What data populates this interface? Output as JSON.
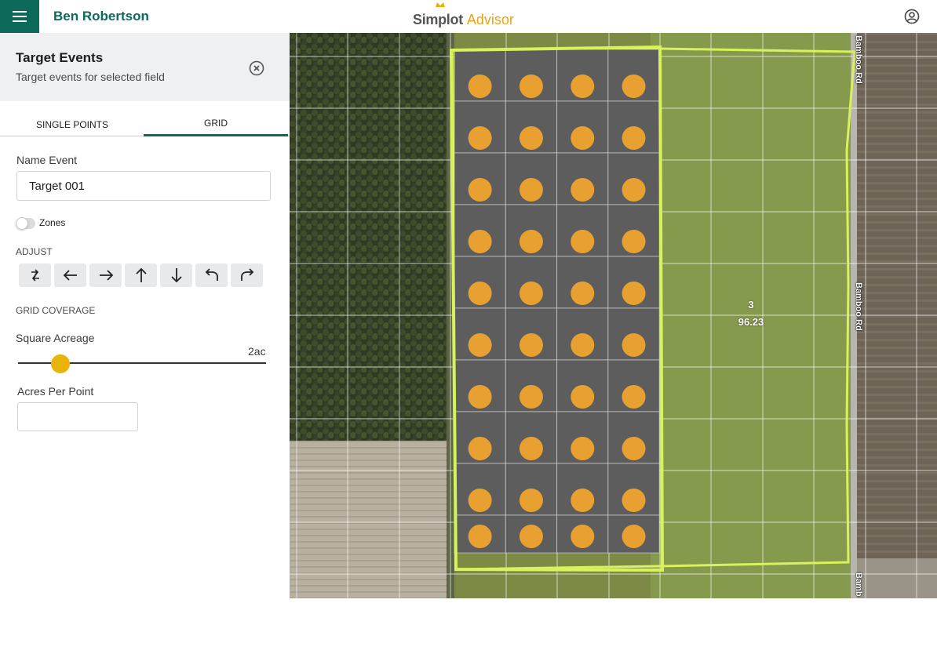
{
  "header": {
    "user_name": "Ben Robertson",
    "logo_primary": "Simplot",
    "logo_secondary": "Advisor"
  },
  "panel": {
    "title": "Target Events",
    "subtitle": "Target events for selected field",
    "tabs": [
      {
        "label": "SINGLE POINTS",
        "active": false
      },
      {
        "label": "GRID",
        "active": true
      }
    ],
    "name_label": "Name Event",
    "name_value": "Target 001",
    "zones_label": "Zones",
    "zones_on": false,
    "adjust_label": "ADJUST",
    "adjust_buttons": [
      "swap-icon",
      "arrow-left-icon",
      "arrow-right-icon",
      "arrow-up-icon",
      "arrow-down-icon",
      "rotate-left-icon",
      "rotate-right-icon"
    ],
    "grid_coverage_label": "GRID COVERAGE",
    "square_acreage_label": "Square Acreage",
    "square_acreage_value": "2ac",
    "acres_per_point_label": "Acres Per Point",
    "acres_per_point_value": ""
  },
  "map": {
    "field_number": "3",
    "field_acres": "96.23",
    "road_labels": [
      "Bamboo Rd",
      "Bamboo Rd",
      "Bamb"
    ],
    "grid_columns": 4,
    "grid_rows": 10,
    "colors": {
      "boundary": "#d7f25a",
      "grid_cell": "#5d5d5d",
      "point": "#e8a030",
      "brand": "#0b6a5a",
      "accent": "#e8b40a"
    }
  }
}
